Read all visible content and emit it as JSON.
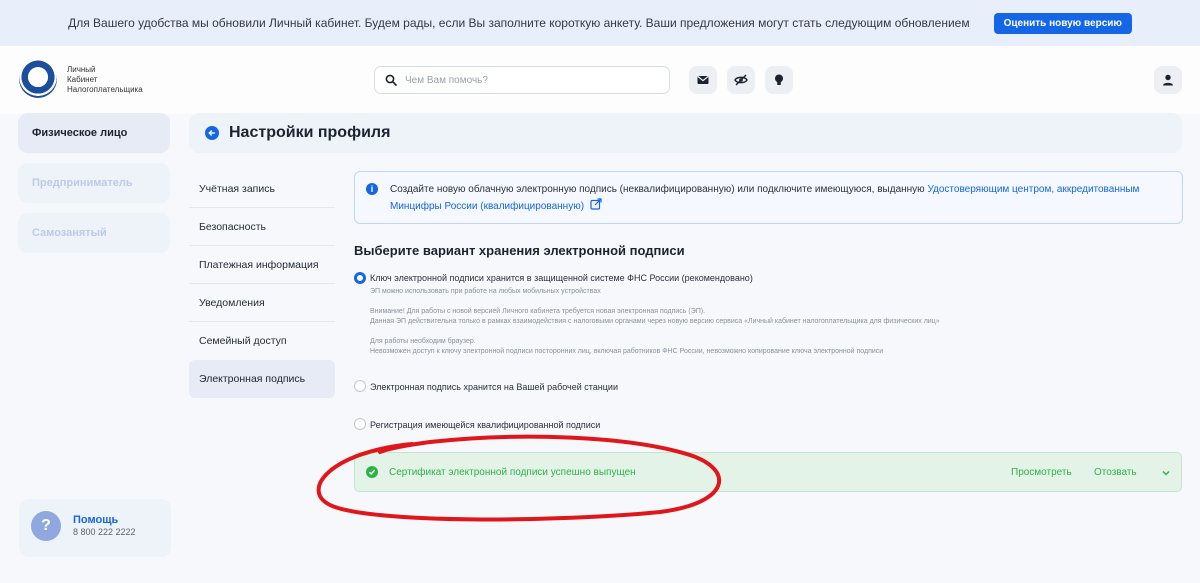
{
  "banner": {
    "text": "Для Вашего удобства мы обновили Личный кабинет. Будем рады, если Вы заполните короткую анкету. Ваши предложения могут стать следующим обновлением",
    "button": "Оценить новую версию"
  },
  "header": {
    "logo_lines": [
      "Личный",
      "Кабинет",
      "Налогоплательщика"
    ],
    "search_placeholder": "Чем Вам помочь?",
    "icons": [
      "mail-icon",
      "eye-off-icon",
      "lightbulb-icon",
      "user-icon"
    ]
  },
  "sidebar": {
    "items": [
      {
        "label": "Физическое лицо",
        "state": "active"
      },
      {
        "label": "Предприниматель",
        "state": "muted"
      },
      {
        "label": "Самозанятый",
        "state": "muted"
      }
    ],
    "help": {
      "icon": "?",
      "title": "Помощь",
      "phone": "8 800 222 2222"
    }
  },
  "page": {
    "title": "Настройки профиля"
  },
  "menu": {
    "items": [
      {
        "label": "Учётная запись"
      },
      {
        "label": "Безопасность"
      },
      {
        "label": "Платежная информация"
      },
      {
        "label": "Уведомления"
      },
      {
        "label": "Семейный доступ"
      },
      {
        "label": "Электронная подпись"
      }
    ],
    "active_index": 5
  },
  "info": {
    "icon": "i",
    "text": "Создайте новую облачную электронную подпись (неквалифицированную) или подключите имеющуюся, выданную ",
    "link": "Удостоверяющим центром, аккредитованным Минцифры России (квалифицированную)"
  },
  "storage": {
    "title": "Выберите вариант хранения электронной подписи",
    "options": [
      {
        "label": "Ключ электронной подписи хранится в защищенной системе ФНС России (рекомендовано)",
        "selected": true,
        "notes": [
          "ЭП можно использовать при работе на любых мобильных устройствах",
          "Внимание! Для работы с новой версией Личного кабинета требуется новая электронная подпись (ЭП).",
          "Данная ЭП действительна только в рамках взаимодействия с налоговыми органами через новую версию сервиса «Личный кабинет налогоплательщика для физических лиц»",
          "Для работы необходим браузер.",
          "Невозможен доступ к ключу электронной подписи посторонних лиц, включая работников ФНС России, невозможно копирование ключа электронной подписи"
        ]
      },
      {
        "label": "Электронная подпись хранится на Вашей рабочей станции",
        "selected": false
      },
      {
        "label": "Регистрация имеющейся квалифицированной подписи",
        "selected": false
      }
    ]
  },
  "certificate": {
    "message": "Сертификат электронной подписи успешно выпущен",
    "view_label": "Просмотреть",
    "revoke_label": "Отозвать"
  },
  "colors": {
    "accent": "#1466e6",
    "success": "#2fb24a",
    "annotation": "#e0161a"
  }
}
